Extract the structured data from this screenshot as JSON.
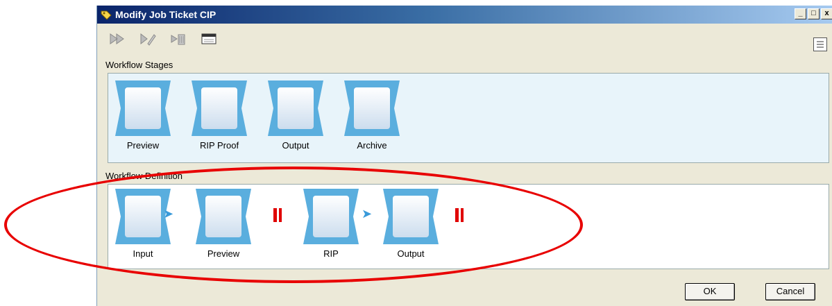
{
  "window": {
    "title": "Modify Job Ticket CIP",
    "controls": [
      "_",
      "□",
      "x"
    ]
  },
  "toolbar": {
    "icons": [
      "add-stage-icon",
      "edit-stage-icon",
      "delete-stage-icon",
      "window-icon"
    ]
  },
  "stages": {
    "label": "Workflow Stages",
    "items": [
      {
        "label": "Preview",
        "icon": "monitor-photo-icon"
      },
      {
        "label": "RIP Proof",
        "icon": "photos-icon"
      },
      {
        "label": "Output",
        "icon": "printer-roll-icon"
      },
      {
        "label": "Archive",
        "icon": "file-cabinet-icon"
      }
    ]
  },
  "definition": {
    "label": "Workflow Definition",
    "items": [
      {
        "label": "Input",
        "icon": "play-arrows-icon"
      },
      {
        "label": "Preview",
        "icon": "monitor-photo-icon"
      },
      {
        "label": "RIP",
        "icon": "display-icon"
      },
      {
        "label": "Output",
        "icon": "printer-roll-icon"
      }
    ]
  },
  "buttons": {
    "ok": "OK",
    "cancel": "Cancel"
  },
  "colors": {
    "highlight_ellipse": "#e80000",
    "tile": "#5aaede",
    "pause": "#e00000",
    "arrow": "#3a9ad9"
  }
}
